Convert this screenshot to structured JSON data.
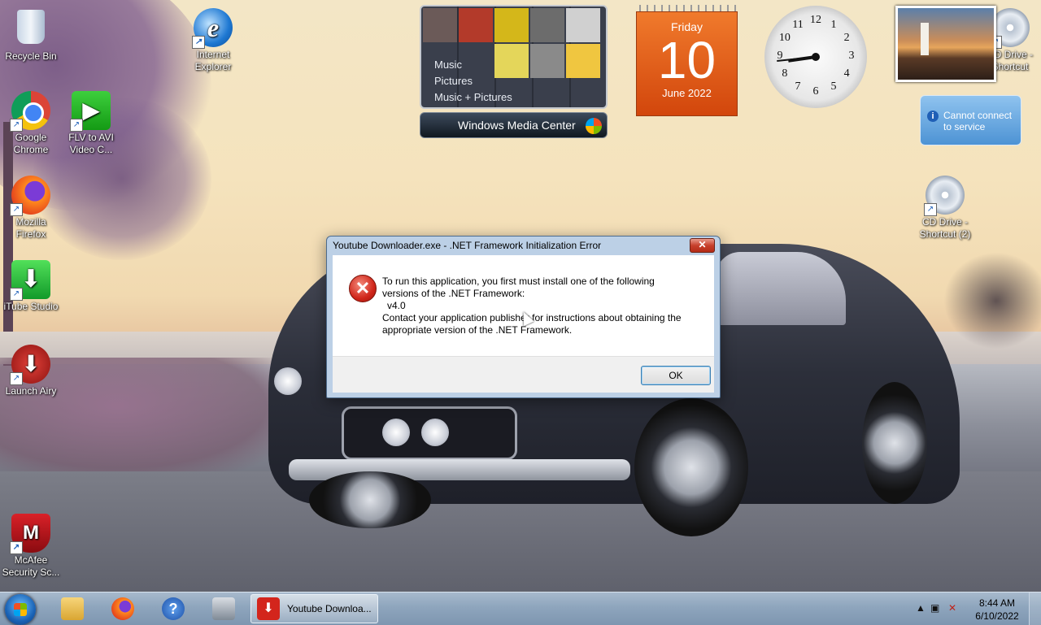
{
  "desktop": {
    "icons": [
      {
        "label": "Recycle Bin"
      },
      {
        "label": "Internet Explorer"
      },
      {
        "label": "Google Chrome"
      },
      {
        "label": "FLV to AVI Video C..."
      },
      {
        "label": "Mozilla Firefox"
      },
      {
        "label": "iTube Studio"
      },
      {
        "label": "Launch Airy"
      },
      {
        "label": "McAfee Security Sc..."
      },
      {
        "label": "CD Drive - Shortcut"
      },
      {
        "label": "CD Drive - Shortcut (2)"
      }
    ]
  },
  "gadgets": {
    "media_center": {
      "items": [
        "Music",
        "Pictures",
        "Music + Pictures"
      ],
      "brand": "Windows Media Center"
    },
    "calendar": {
      "day": "Friday",
      "date": "10",
      "month": "June 2022"
    },
    "clock": {
      "numbers": [
        "12",
        "1",
        "2",
        "3",
        "4",
        "5",
        "6",
        "7",
        "8",
        "9",
        "10",
        "11"
      ],
      "hour": 8,
      "minute": 44
    },
    "weather": {
      "message": "Cannot connect to service"
    }
  },
  "dialog": {
    "title": "Youtube Downloader.exe - .NET Framework Initialization Error",
    "close_label": "✕",
    "lines": [
      "To run this application, you first must install one of the following",
      "versions of the .NET Framework:",
      "v4.0",
      "Contact your application publisher for instructions about obtaining the",
      "appropriate version of the .NET Framework."
    ],
    "ok_label": "OK"
  },
  "taskbar": {
    "active_window": "Youtube Downloa...",
    "time": "8:44 AM",
    "date": "6/10/2022",
    "accent": "#1a63b6"
  }
}
